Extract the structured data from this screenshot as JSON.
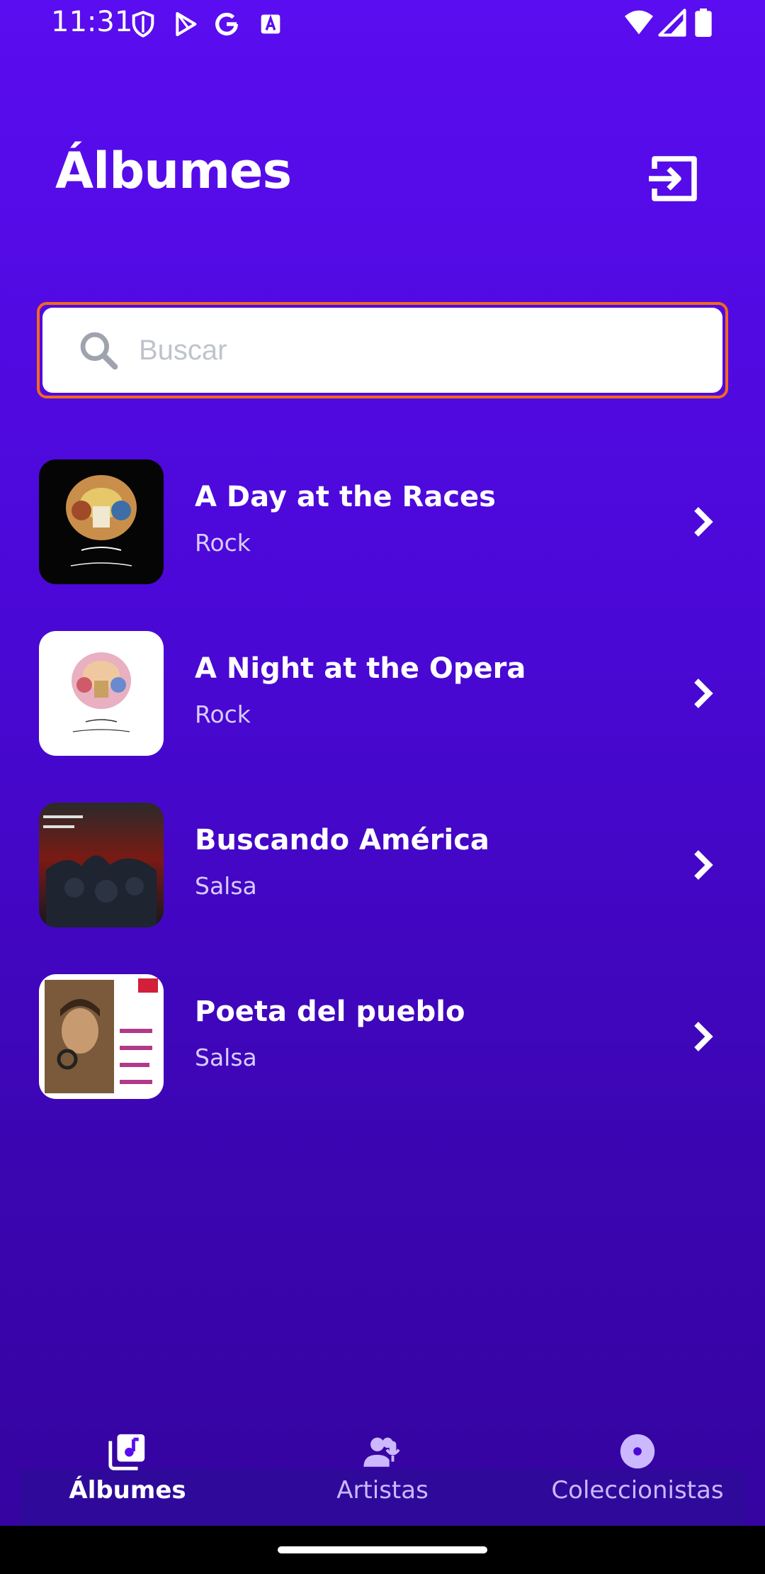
{
  "status_bar": {
    "time": "11:31"
  },
  "header": {
    "title": "Álbumes"
  },
  "search": {
    "placeholder": "Buscar"
  },
  "albums": [
    {
      "title": "A Day at the Races",
      "genre": "Rock"
    },
    {
      "title": "A Night at the Opera",
      "genre": "Rock"
    },
    {
      "title": "Buscando América",
      "genre": "Salsa"
    },
    {
      "title": "Poeta del pueblo",
      "genre": "Salsa"
    }
  ],
  "bottom_nav": {
    "items": [
      {
        "label": "Álbumes",
        "icon": "album-icon",
        "active": true
      },
      {
        "label": "Artistas",
        "icon": "artists-icon",
        "active": false
      },
      {
        "label": "Coleccionistas",
        "icon": "collectors-icon",
        "active": false
      }
    ]
  },
  "colors": {
    "background": "#5a0df0",
    "search_border": "#f26a1b",
    "inactive_nav": "#cbb8ff"
  }
}
